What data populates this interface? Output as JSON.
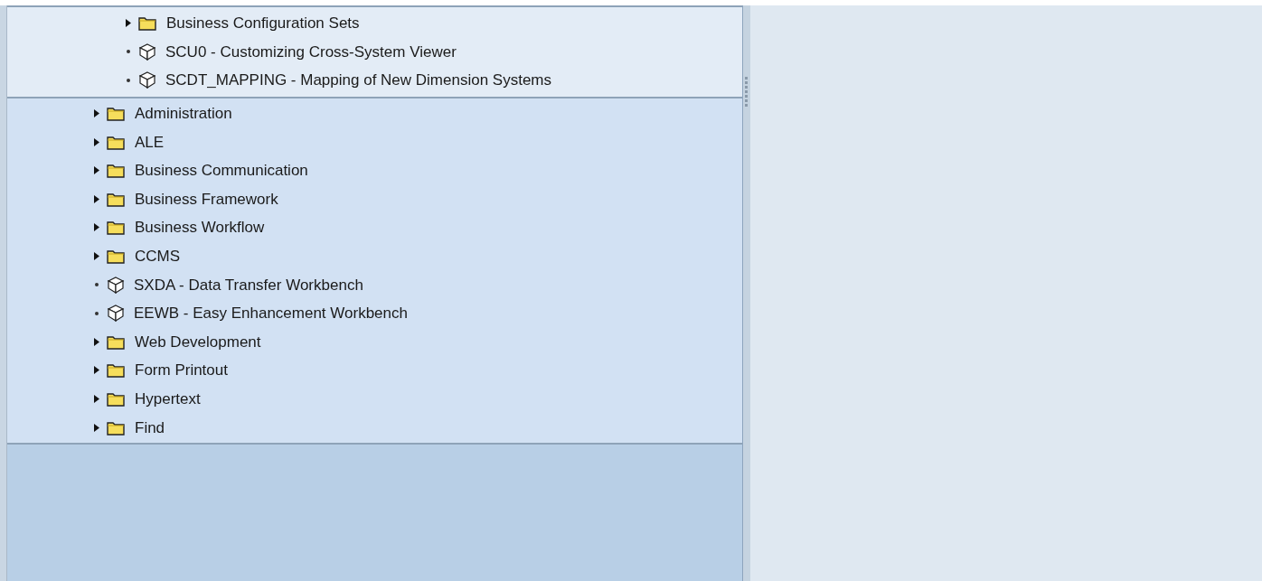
{
  "nested_items": [
    {
      "kind": "folder",
      "label": "Business Configuration Sets",
      "expanded": false
    },
    {
      "kind": "transaction",
      "label": "SCU0 - Customizing Cross-System Viewer"
    },
    {
      "kind": "transaction",
      "label": "SCDT_MAPPING - Mapping of New Dimension Systems"
    }
  ],
  "items": [
    {
      "kind": "folder",
      "label": "Administration",
      "expanded": false
    },
    {
      "kind": "folder",
      "label": "ALE",
      "expanded": false
    },
    {
      "kind": "folder",
      "label": "Business Communication",
      "expanded": false
    },
    {
      "kind": "folder",
      "label": "Business Framework",
      "expanded": false
    },
    {
      "kind": "folder",
      "label": "Business Workflow",
      "expanded": false
    },
    {
      "kind": "folder",
      "label": "CCMS",
      "expanded": false
    },
    {
      "kind": "transaction",
      "label": "SXDA - Data Transfer Workbench"
    },
    {
      "kind": "transaction",
      "label": "EEWB - Easy Enhancement Workbench"
    },
    {
      "kind": "folder",
      "label": "Web Development",
      "expanded": false
    },
    {
      "kind": "folder",
      "label": "Form Printout",
      "expanded": false
    },
    {
      "kind": "folder",
      "label": "Hypertext",
      "expanded": false
    },
    {
      "kind": "folder",
      "label": "Find",
      "expanded": false
    }
  ]
}
